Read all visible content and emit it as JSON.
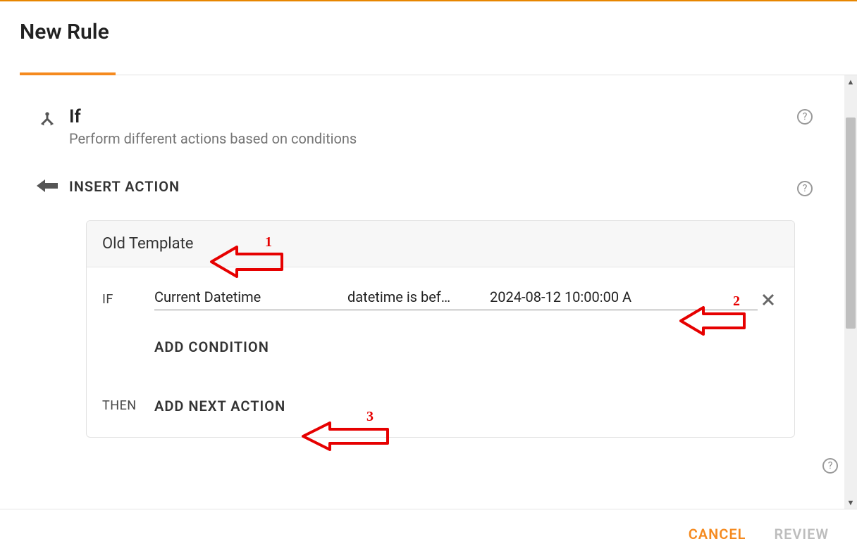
{
  "dialog": {
    "title": "New Rule"
  },
  "ifBlock": {
    "title": "If",
    "description": "Perform different actions based on conditions"
  },
  "insertAction": {
    "label": "INSERT ACTION"
  },
  "card": {
    "header": "Old Template",
    "condition": {
      "ifLabel": "IF",
      "field": "Current Datetime",
      "operator": "datetime is bef…",
      "value": "2024-08-12 10:00:00 A"
    },
    "addCondition": "ADD CONDITION",
    "thenLabel": "THEN",
    "addNextAction": "ADD NEXT ACTION"
  },
  "footer": {
    "cancel": "CANCEL",
    "review": "REVIEW"
  },
  "annotations": {
    "a1": "1",
    "a2": "2",
    "a3": "3"
  }
}
